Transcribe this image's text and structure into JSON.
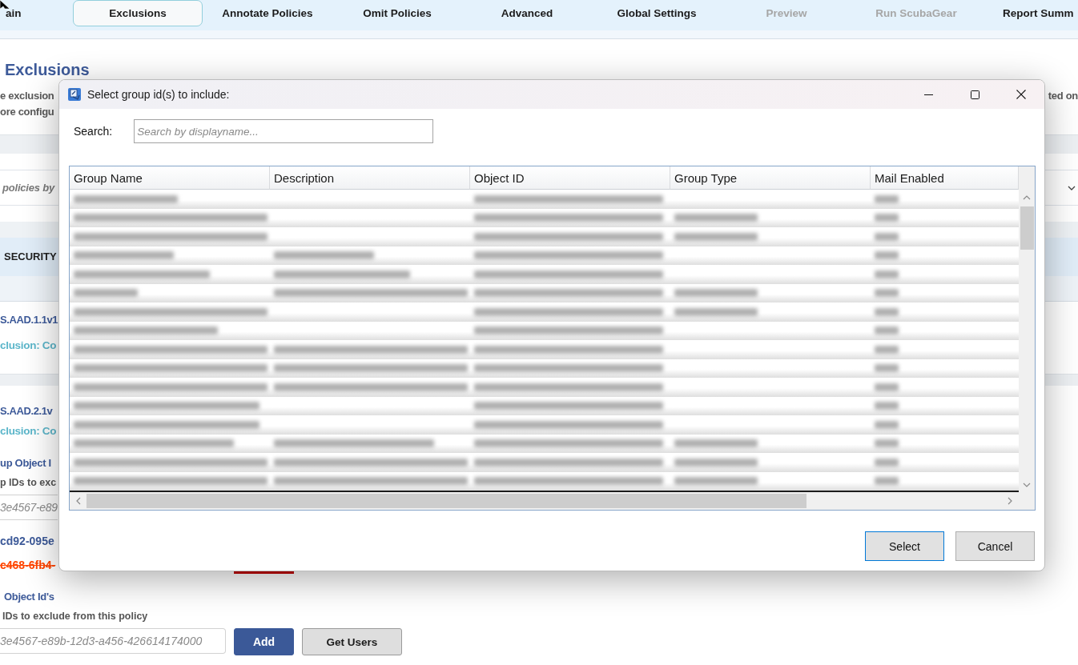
{
  "nav_tabs": [
    {
      "label": "ain",
      "selected": false,
      "disabled": false
    },
    {
      "label": "Exclusions",
      "selected": true,
      "disabled": false
    },
    {
      "label": "Annotate Policies",
      "selected": false,
      "disabled": false
    },
    {
      "label": "Omit Policies",
      "selected": false,
      "disabled": false
    },
    {
      "label": "Advanced",
      "selected": false,
      "disabled": false
    },
    {
      "label": "Global Settings",
      "selected": false,
      "disabled": false
    },
    {
      "label": "Preview",
      "selected": false,
      "disabled": true
    },
    {
      "label": "Run ScubaGear",
      "selected": false,
      "disabled": true
    },
    {
      "label": "Report Summ",
      "selected": false,
      "disabled": false
    }
  ],
  "page": {
    "heading": "Exclusions",
    "description_left": [
      "e exclusion",
      "ore configu"
    ],
    "description_right": "ted on",
    "policy_filter": {
      "placeholder": "policies by"
    },
    "product_header": "SECURITY",
    "policies": [
      {
        "id": "S.AAD.1.1v1",
        "exclusion": "clusion: Co"
      },
      {
        "id": "S.AAD.2.1v",
        "exclusion": "clusion: Co"
      }
    ],
    "group_section": {
      "title": "up Object I",
      "hint": "p IDs to exc",
      "input": {
        "placeholder": "3e4567-e89"
      },
      "entries": [
        {
          "text": "cd92-095e",
          "removed": false
        },
        {
          "text": "c468-6fb4-",
          "removed": true
        }
      ]
    },
    "user_section": {
      "title": "Object Id's",
      "hint": "IDs to exclude from this policy",
      "input": {
        "placeholder": "3e4567-e89b-12d3-a456-426614174000"
      },
      "buttons": [
        {
          "label": "Add",
          "kind": "primary"
        },
        {
          "label": "Get Users",
          "kind": "secondary"
        }
      ]
    }
  },
  "dialog": {
    "title": "Select group id(s) to include:",
    "search": {
      "label": "Search:",
      "placeholder": "Search by displayname..."
    },
    "table": {
      "columns": [
        "Group Name",
        "Description",
        "Object ID",
        "Group Type",
        "Mail Enabled"
      ],
      "rows_blurred": true
    },
    "buttons": [
      {
        "label": "Select",
        "default": true
      },
      {
        "label": "Cancel",
        "default": false
      }
    ]
  }
}
